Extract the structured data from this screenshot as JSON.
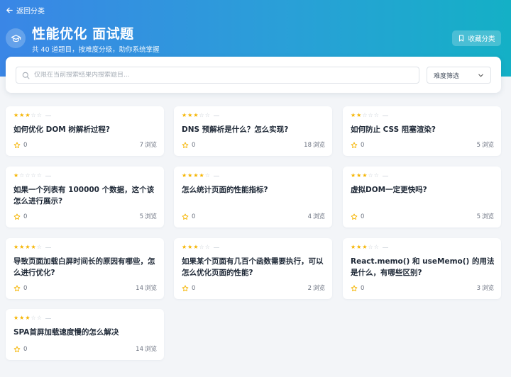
{
  "nav": {
    "back_label": "返回分类"
  },
  "header": {
    "title": "性能优化 面试题",
    "subtitle": "共 40 道题目，按难度分级，助你系统掌握",
    "favorite_label": "收藏分类"
  },
  "search": {
    "placeholder": "仅限在当前搜索结果内搜索题目...",
    "value": ""
  },
  "filter": {
    "label": "难度筛选"
  },
  "views_unit": "浏览",
  "cards": [
    {
      "title": "如何优化 DOM 树解析过程?",
      "difficulty": 3,
      "stars_total": 5,
      "favorites": "0",
      "views": "7"
    },
    {
      "title": "DNS 预解析是什么？怎么实现?",
      "difficulty": 3,
      "stars_total": 5,
      "favorites": "0",
      "views": "18"
    },
    {
      "title": "如何防止 CSS 阻塞渲染?",
      "difficulty": 2,
      "stars_total": 5,
      "favorites": "0",
      "views": "5"
    },
    {
      "title": "如果一个列表有 100000 个数据，这个该怎么进行展示?",
      "difficulty": 1,
      "stars_total": 5,
      "favorites": "0",
      "views": "5"
    },
    {
      "title": "怎么统计页面的性能指标?",
      "difficulty": 4,
      "stars_total": 5,
      "favorites": "0",
      "views": "4"
    },
    {
      "title": "虚拟DOM一定更快吗?",
      "difficulty": 3,
      "stars_total": 5,
      "favorites": "0",
      "views": "5"
    },
    {
      "title": "导致页面加载白屏时间长的原因有哪些，怎么进行优化?",
      "difficulty": 4,
      "stars_total": 5,
      "favorites": "0",
      "views": "14"
    },
    {
      "title": "如果某个页面有几百个函数需要执行，可以怎么优化页面的性能?",
      "difficulty": 3,
      "stars_total": 5,
      "favorites": "0",
      "views": "2"
    },
    {
      "title": "React.memo() 和 useMemo() 的用法是什么，有哪些区别?",
      "difficulty": 3,
      "stars_total": 5,
      "favorites": "0",
      "views": "3"
    },
    {
      "title": "SPA首屏加载速度慢的怎么解决",
      "difficulty": 3,
      "stars_total": 5,
      "favorites": "0",
      "views": "14"
    }
  ],
  "colors": {
    "header_gradient_start": "#3a86e6",
    "header_gradient_end": "#14b0c6",
    "star_active": "#f5b400",
    "star_inactive": "#c9cfd6",
    "page_background": "#f3f5f8"
  }
}
